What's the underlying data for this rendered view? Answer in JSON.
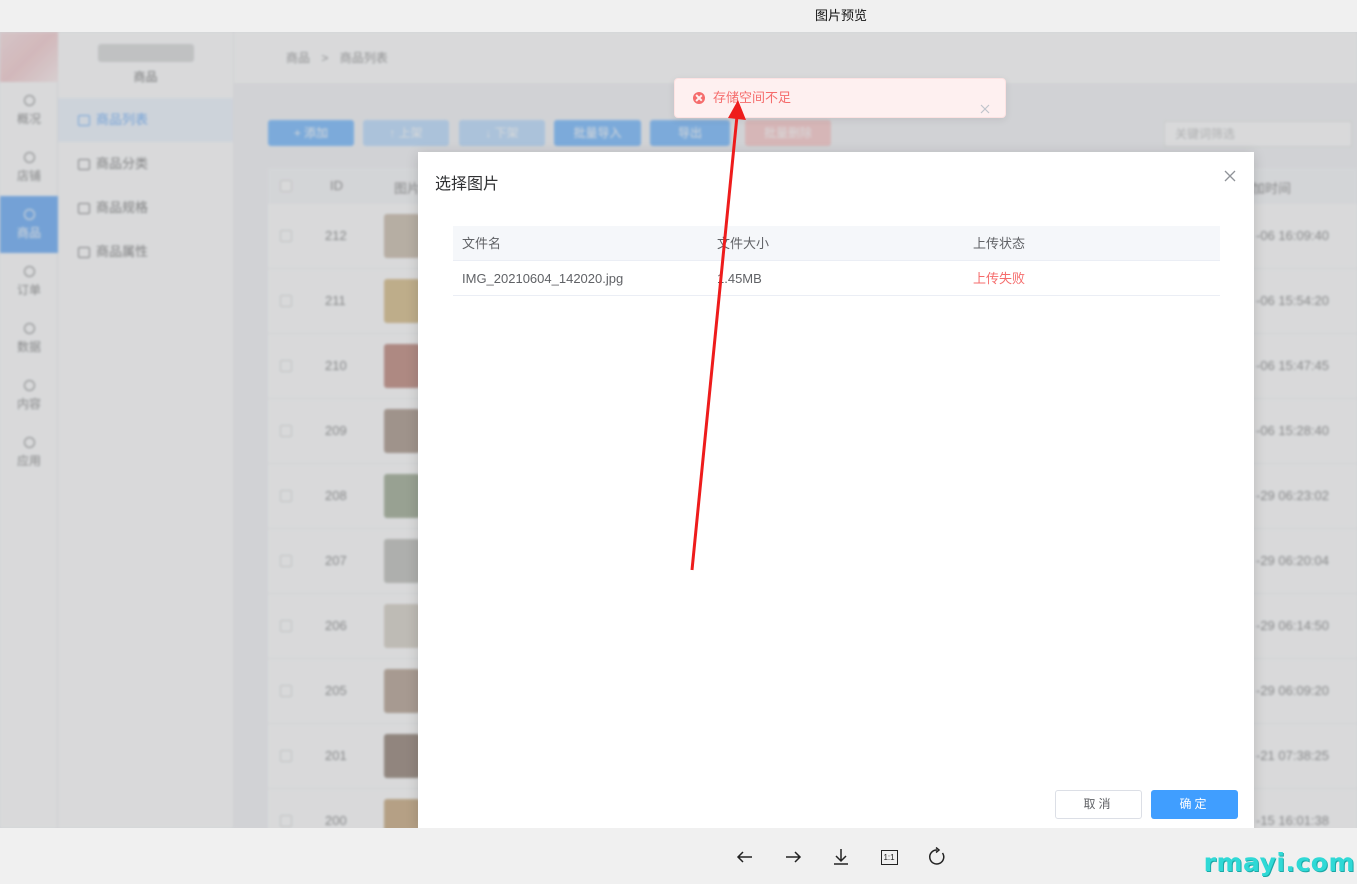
{
  "viewer": {
    "title": "图片预览",
    "tools": [
      "arrow-left-icon",
      "arrow-right-icon",
      "download-icon",
      "actual-size-icon",
      "rotate-icon"
    ],
    "actual_size_label": "1:1",
    "watermark": "rmayi.com"
  },
  "app": {
    "rail": [
      {
        "label": "概况",
        "active": false
      },
      {
        "label": "店铺",
        "active": false
      },
      {
        "label": "商品",
        "active": true
      },
      {
        "label": "订单",
        "active": false
      },
      {
        "label": "数据",
        "active": false
      },
      {
        "label": "内容",
        "active": false
      },
      {
        "label": "应用",
        "active": false
      }
    ],
    "subnav_title": "商品",
    "subnav": [
      {
        "label": "商品列表",
        "active": true
      },
      {
        "label": "商品分类",
        "active": false
      },
      {
        "label": "商品规格",
        "active": false
      },
      {
        "label": "商品属性",
        "active": false
      }
    ],
    "breadcrumb": [
      "商品",
      "商品列表"
    ],
    "toolbar": [
      {
        "label": "+ 添加",
        "color": "#409eff"
      },
      {
        "label": "↑ 上架",
        "color": "#a0cfff"
      },
      {
        "label": "↓ 下架",
        "color": "#a0cfff"
      },
      {
        "label": "批量导入",
        "color": "#409eff"
      },
      {
        "label": "导出",
        "color": "#409eff"
      },
      {
        "label": "批量删除",
        "color": "#fab6b6"
      }
    ],
    "search_placeholder": "关键词筛选",
    "table_headers": {
      "id": "ID",
      "image": "图片",
      "time": "加时间"
    },
    "rows": [
      {
        "id": "212",
        "time": "-06 16:09:40"
      },
      {
        "id": "211",
        "time": "-06 15:54:20"
      },
      {
        "id": "210",
        "time": "-06 15:47:45"
      },
      {
        "id": "209",
        "time": "-06 15:28:40"
      },
      {
        "id": "208",
        "time": "-29 06:23:02"
      },
      {
        "id": "207",
        "time": "-29 06:20:04"
      },
      {
        "id": "206",
        "time": "-29 06:14:50"
      },
      {
        "id": "205",
        "time": "-29 06:09:20"
      },
      {
        "id": "201",
        "time": "-21 07:38:25"
      },
      {
        "id": "200",
        "time": "-15 16:01:38"
      }
    ]
  },
  "dialog": {
    "title": "选择图片",
    "columns": {
      "name": "文件名",
      "size": "文件大小",
      "status": "上传状态"
    },
    "files": [
      {
        "name": "IMG_20210604_142020.jpg",
        "size": "1.45MB",
        "status": "上传失败"
      }
    ],
    "cancel_label": "取消",
    "confirm_label": "确定"
  },
  "toast": {
    "message": "存储空间不足",
    "type": "error"
  },
  "colors": {
    "primary": "#409eff",
    "danger": "#f56c6c",
    "annotation_arrow": "#ee1c1c",
    "watermark": "#2fd9d6"
  }
}
